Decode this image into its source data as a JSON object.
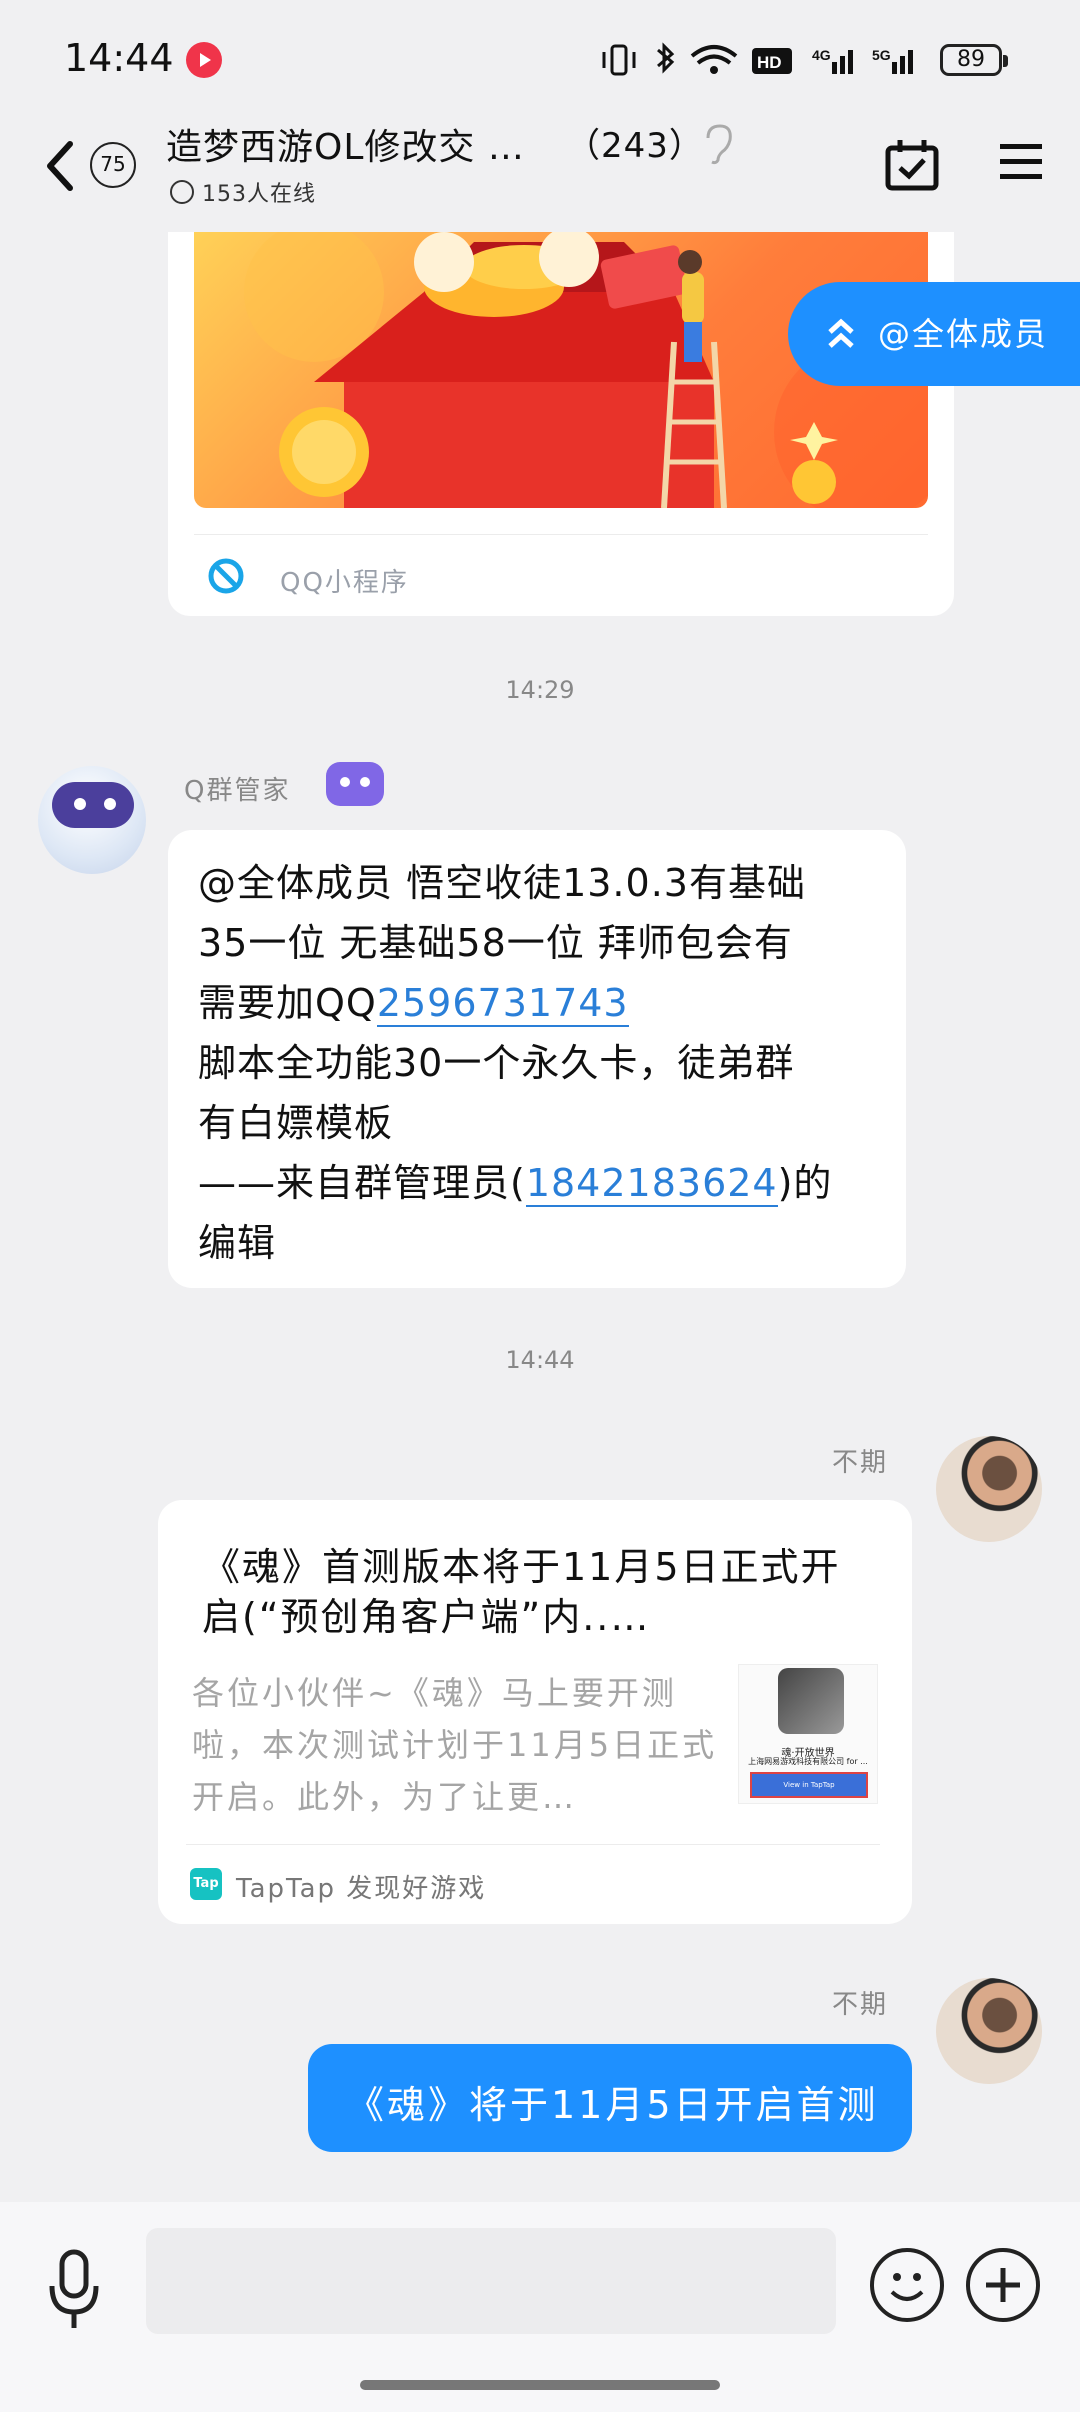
{
  "status_bar": {
    "time": "14:44",
    "battery": "89"
  },
  "header": {
    "unread_count": "75",
    "title": "造梦西游OL修改交 …",
    "member_count": "（243）",
    "online": "153人在线"
  },
  "at_all_banner": "@全体成员",
  "mini_program": {
    "source_label": "QQ小程序"
  },
  "timestamps": [
    "14:29",
    "14:44"
  ],
  "bot_message": {
    "sender": "Q群管家",
    "lines": [
      "@全体成员 悟空收徒13.0.3有基础",
      "35一位   无基础58一位 拜师包会有",
      "需要加QQ",
      "2596731743",
      "脚本全功能30一个永久卡，徒弟群",
      "有白嫖模板",
      "——来自群管理员(",
      "1842183624",
      ")的",
      "编辑"
    ]
  },
  "share_message": {
    "sender": "不期",
    "title_line1": "《魂》首测版本将于11月5日正式开",
    "title_line2": "启(“预创角客户端”内..…",
    "desc_line1": "各位小伙伴~《魂》马上要开测",
    "desc_line2": "啦，本次测试计划于11月5日正式",
    "desc_line3": "开启。此外，为了让更…",
    "thumb_text1": "魂·开放世界",
    "thumb_text2": "上海网易游戏科技有限公司 for ...",
    "thumb_button": "View in TapTap",
    "source_icon": "Tap",
    "source_label": "TapTap 发现好游戏"
  },
  "text_message": {
    "sender": "不期",
    "text": "《魂》将于11月5日开启首测"
  },
  "colors": {
    "accent": "#1e90ff",
    "link": "#2a7fd8",
    "bot_badge": "#8067e6"
  }
}
